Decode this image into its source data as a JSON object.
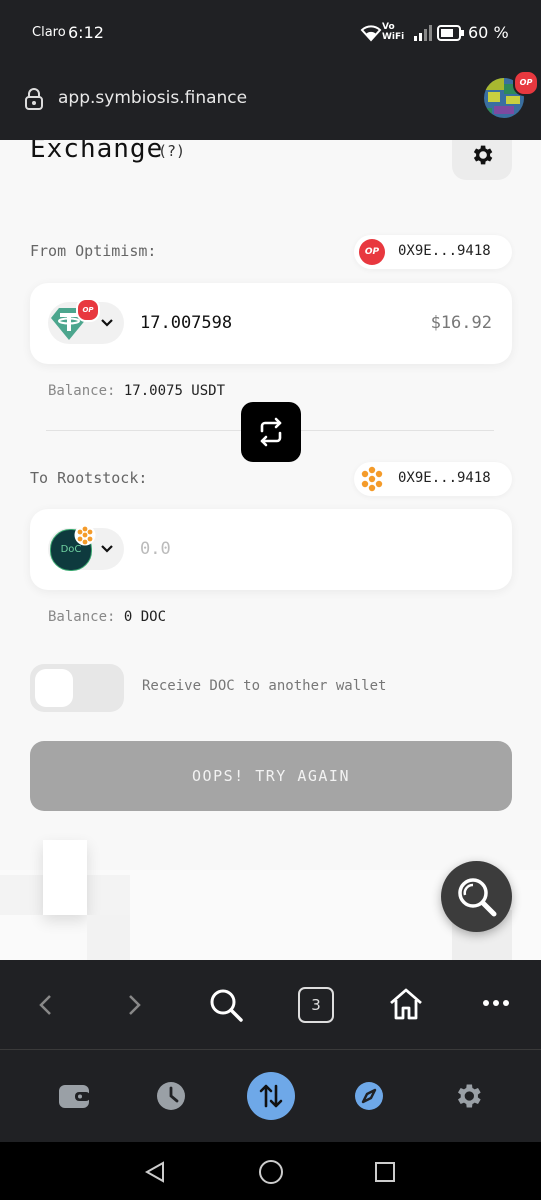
{
  "status_bar": {
    "carrier": "Claro",
    "time": "6:12",
    "vowifi_top": "Vo",
    "vowifi_bottom": "WiFi",
    "battery": "60 %"
  },
  "url_bar": {
    "url": "app.symbiosis.finance",
    "avatar_badge": "OP"
  },
  "exchange": {
    "title": "Exchange",
    "help": "(?)",
    "from_label": "From Optimism:",
    "from_chain_badge": "OP",
    "from_address": "0X9E...9418",
    "from_token_badge": "OP",
    "from_amount": "17.007598",
    "from_usd": "$16.92",
    "from_balance_label": "Balance:",
    "from_balance_value": "17.0075 USDT",
    "to_label": "To Rootstock:",
    "to_address": "0X9E...9418",
    "to_token_text": "DoC",
    "to_amount_placeholder": "0.0",
    "to_balance_label": "Balance:",
    "to_balance_value": "0 DOC",
    "receive_toggle_label": "Receive DOC to another wallet",
    "submit_label": "OOPS! TRY AGAIN"
  },
  "browser_nav": {
    "tab_count": "3"
  },
  "colors": {
    "op_red": "#e8383f",
    "rootstock_orange": "#f49b2a",
    "accent_blue": "#6ea8e8",
    "toolbar_bg": "#202124"
  },
  "icons": [
    "lock-icon",
    "gear-icon",
    "chevron-down-icon",
    "swap-icon",
    "search-icon",
    "back-icon",
    "forward-icon",
    "home-icon",
    "more-icon",
    "wallet-icon",
    "history-icon",
    "exchange-icon",
    "compass-icon",
    "settings-icon"
  ]
}
